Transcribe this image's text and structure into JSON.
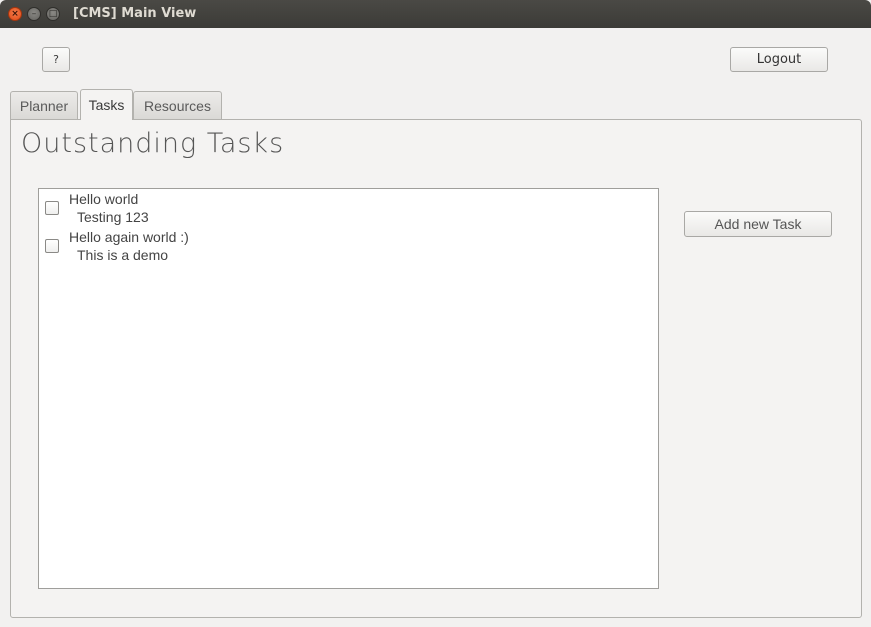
{
  "window": {
    "title": "[CMS] Main View",
    "controls": {
      "close_icon": "close-icon",
      "minimize_icon": "minimize-icon",
      "maximize_icon": "maximize-icon",
      "close_glyph": "×",
      "minimize_glyph": "–",
      "maximize_glyph": "□"
    }
  },
  "toolbar": {
    "help_label": "?",
    "logout_label": "Logout"
  },
  "tabs": [
    {
      "label": "Planner",
      "selected": false
    },
    {
      "label": "Tasks",
      "selected": true
    },
    {
      "label": "Resources",
      "selected": false
    }
  ],
  "main": {
    "heading": "Outstanding Tasks",
    "tasks": [
      {
        "title": "Hello world",
        "description": "Testing 123",
        "checked": false
      },
      {
        "title": "Hello again world :)",
        "description": "This is a demo",
        "checked": false
      }
    ],
    "add_task_label": "Add new Task"
  },
  "colors": {
    "titlebar": "#3c3b37",
    "close_button": "#df4a16",
    "background": "#f2f1f0",
    "list_background": "#ffffff"
  }
}
